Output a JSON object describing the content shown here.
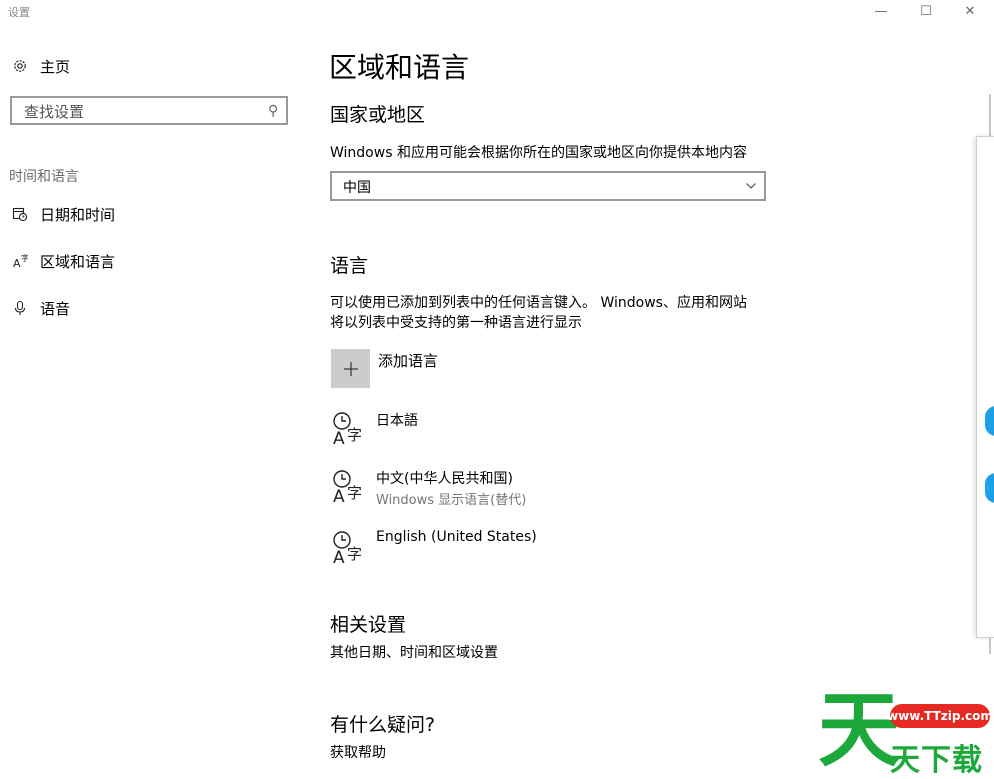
{
  "window": {
    "title": "设置",
    "minimize_glyph": "—",
    "maximize_glyph": "☐",
    "close_glyph": "✕"
  },
  "sidebar": {
    "home_label": "主页",
    "search_placeholder": "查找设置",
    "group_label": "时间和语言",
    "items": [
      {
        "label": "日期和时间",
        "icon": "calendar-clock-icon"
      },
      {
        "label": "区域和语言",
        "icon": "language-icon"
      },
      {
        "label": "语音",
        "icon": "microphone-icon"
      }
    ]
  },
  "main": {
    "title": "区域和语言",
    "country": {
      "heading": "国家或地区",
      "description": "Windows 和应用可能会根据你所在的国家或地区向你提供本地内容",
      "selected": "中国"
    },
    "language": {
      "heading": "语言",
      "description_line1": "可以使用已添加到列表中的任何语言键入。 Windows、应用和网站",
      "description_line2": "将以列表中受支持的第一种语言进行显示",
      "add_label": "添加语言",
      "items": [
        {
          "name": "日本語",
          "sub": ""
        },
        {
          "name": "中文(中华人民共和国)",
          "sub": "Windows 显示语言(替代)"
        },
        {
          "name": "English (United States)",
          "sub": ""
        }
      ]
    },
    "related": {
      "heading": "相关设置",
      "link": "其他日期、时间和区域设置"
    },
    "help": {
      "heading": "有什么疑问?",
      "link": "获取帮助"
    }
  },
  "watermark": {
    "big_char": "天",
    "url": "www.TTzip.com",
    "text": "天下载"
  },
  "colors": {
    "accent_blue": "#1ea0e6",
    "watermark_green": "#1ca83a",
    "watermark_red": "#e52a23"
  }
}
